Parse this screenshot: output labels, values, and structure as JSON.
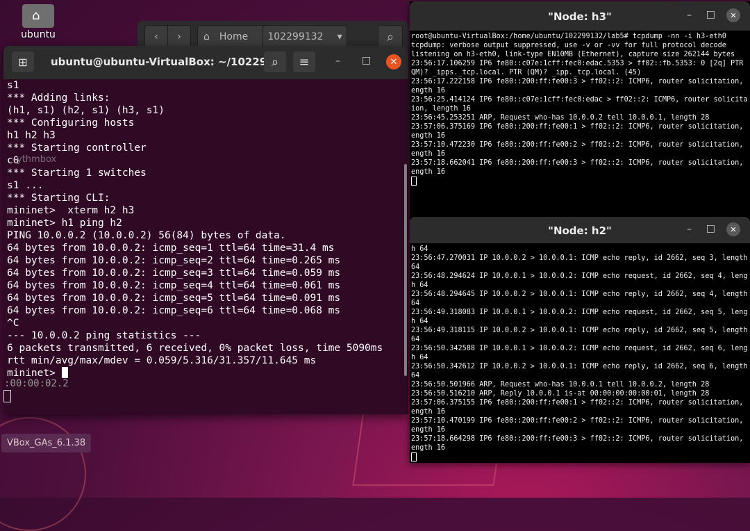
{
  "desktop": {
    "home_icon_label": "ubuntu",
    "vbox_label": "VBox_GAs_6.1.38",
    "stray_text_1": "ythmbox",
    "stray_text_2": ":00:00:02.2"
  },
  "files": {
    "back": "‹",
    "forward": "›",
    "home_label": "Home",
    "path_label": "102299132",
    "dropdown": "▾",
    "search": "⌕"
  },
  "terminal": {
    "title": "ubuntu@ubuntu-VirtualBox: ~/102299...",
    "new_tab": "⊞",
    "search": "⌕",
    "menu": "≡",
    "minimize": "–",
    "maximize": "□",
    "close": "✕",
    "lines": [
      "s1",
      "*** Adding links:",
      "(h1, s1) (h2, s1) (h3, s1)",
      "*** Configuring hosts",
      "h1 h2 h3",
      "*** Starting controller",
      "c0",
      "*** Starting 1 switches",
      "s1 ...",
      "*** Starting CLI:",
      "mininet>  xterm h2 h3",
      "mininet> h1 ping h2",
      "PING 10.0.0.2 (10.0.0.2) 56(84) bytes of data.",
      "64 bytes from 10.0.0.2: icmp_seq=1 ttl=64 time=31.4 ms",
      "64 bytes from 10.0.0.2: icmp_seq=2 ttl=64 time=0.265 ms",
      "64 bytes from 10.0.0.2: icmp_seq=3 ttl=64 time=0.059 ms",
      "64 bytes from 10.0.0.2: icmp_seq=4 ttl=64 time=0.061 ms",
      "64 bytes from 10.0.0.2: icmp_seq=5 ttl=64 time=0.091 ms",
      "64 bytes from 10.0.0.2: icmp_seq=6 ttl=64 time=0.068 ms",
      "^C",
      "--- 10.0.0.2 ping statistics ---",
      "6 packets transmitted, 6 received, 0% packet loss, time 5090ms",
      "rtt min/avg/max/mdev = 0.059/5.316/31.357/11.645 ms"
    ],
    "prompt": "mininet> "
  },
  "node_h3": {
    "title": "\"Node: h3\"",
    "minimize": "–",
    "maximize": "□",
    "close": "✕",
    "lines": [
      "root@ubuntu-VirtualBox:/home/ubuntu/102299132/lab5# tcpdump -nn -i h3-eth0",
      "tcpdump: verbose output suppressed, use -v or -vv for full protocol decode",
      "listening on h3-eth0, link-type EN10MB (Ethernet), capture size 262144 bytes",
      "23:56:17.106259 IP6 fe80::c07e:1cff:fec0:edac.5353 > ff02::fb.5353: 0 [2q] PTR (",
      "QM)? _ipps._tcp.local. PTR (QM)? _ipp._tcp.local. (45)",
      "23:56:17.222158 IP6 fe80::200:ff:fe00:3 > ff02::2: ICMP6, router solicitation, l",
      "ength 16",
      "23:56:25.414124 IP6 fe80::c07e:1cff:fec0:edac > ff02::2: ICMP6, router solicitat",
      "ion, length 16",
      "23:56:45.253251 ARP, Request who-has 10.0.0.2 tell 10.0.0.1, length 28",
      "23:57:06.375169 IP6 fe80::200:ff:fe00:1 > ff02::2: ICMP6, router solicitation, l",
      "ength 16",
      "23:57:10.472230 IP6 fe80::200:ff:fe00:2 > ff02::2: ICMP6, router solicitation, l",
      "ength 16",
      "23:57:18.662041 IP6 fe80::200:ff:fe00:3 > ff02::2: ICMP6, router solicitation, l",
      "ength 16"
    ]
  },
  "node_h2": {
    "title": "\"Node: h2\"",
    "minimize": "–",
    "maximize": "□",
    "close": "✕",
    "lines": [
      "h 64",
      "23:56:47.270031 IP 10.0.0.2 > 10.0.0.1: ICMP echo reply, id 2662, seq 3, length",
      "64",
      "23:56:48.294624 IP 10.0.0.1 > 10.0.0.2: ICMP echo request, id 2662, seq 4, lengt",
      "h 64",
      "23:56:48.294645 IP 10.0.0.2 > 10.0.0.1: ICMP echo reply, id 2662, seq 4, length",
      "64",
      "23:56:49.318083 IP 10.0.0.1 > 10.0.0.2: ICMP echo request, id 2662, seq 5, lengt",
      "h 64",
      "23:56:49.318115 IP 10.0.0.2 > 10.0.0.1: ICMP echo reply, id 2662, seq 5, length",
      "64",
      "23:56:50.342588 IP 10.0.0.1 > 10.0.0.2: ICMP echo request, id 2662, seq 6, lengt",
      "h 64",
      "23:56:50.342612 IP 10.0.0.2 > 10.0.0.1: ICMP echo reply, id 2662, seq 6, length",
      "64",
      "23:56:50.501966 ARP, Request who-has 10.0.0.1 tell 10.0.0.2, length 28",
      "23:56:50.516210 ARP, Reply 10.0.0.1 is-at 00:00:00:00:00:01, length 28",
      "23:57:06.375155 IP6 fe80::200:ff:fe00:1 > ff02::2: ICMP6, router solicitation, l",
      "ength 16",
      "23:57:10.470199 IP6 fe80::200:ff:fe00:2 > ff02::2: ICMP6, router solicitation, l",
      "ength 16",
      "23:57:18.664298 IP6 fe80::200:ff:fe00:3 > ff02::2: ICMP6, router solicitation, l",
      "ength 16"
    ]
  },
  "colors": {
    "terminal_bg": "#300a24",
    "close_accent": "#e95420",
    "titlebar": "#2c2c2c"
  }
}
